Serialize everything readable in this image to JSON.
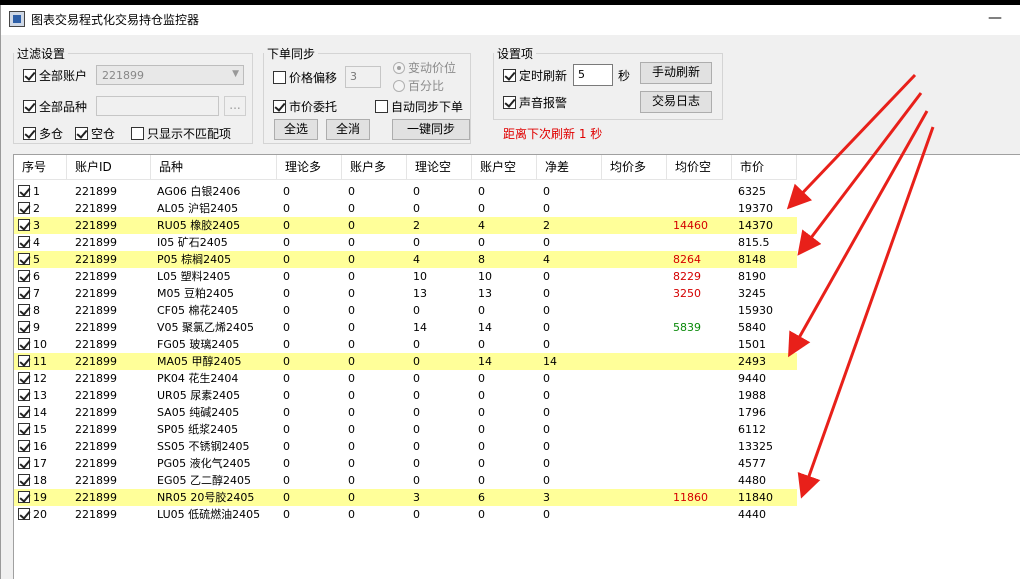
{
  "window": {
    "title": "图表交易程式化交易持仓监控器",
    "minimize": "—"
  },
  "filter": {
    "legend": "过滤设置",
    "all_accounts": "全部账户",
    "account_value": "221899",
    "all_products": "全部品种",
    "browse": "...",
    "long": "多仓",
    "short": "空仓",
    "only_mismatch": "只显示不匹配项"
  },
  "order_sync": {
    "legend": "下单同步",
    "price_offset": "价格偏移",
    "offset_value": "3",
    "radio_tick": "变动价位",
    "radio_percent": "百分比",
    "market_order": "市价委托",
    "auto_sync": "自动同步下单",
    "select_all": "全选",
    "cancel_all": "全消",
    "sync_button": "一键同步"
  },
  "settings": {
    "legend": "设置项",
    "timed_refresh": "定时刷新",
    "interval": "5",
    "unit": "秒",
    "manual_refresh": "手动刷新",
    "sound_alarm": "声音报警",
    "trade_log": "交易日志",
    "countdown": "距离下次刷新 1 秒"
  },
  "table": {
    "headers": [
      "序号",
      "账户ID",
      "品种",
      "理论多",
      "账户多",
      "理论空",
      "账户空",
      "净差",
      "均价多",
      "均价空",
      "市价"
    ],
    "rows": [
      {
        "no": "1",
        "acct": "221899",
        "prod": "AG06 白银2406",
        "tl": "0",
        "al": "0",
        "ts": "0",
        "as": "0",
        "net": "0",
        "avl": "",
        "avs": "",
        "avs_color": "",
        "price": "6325",
        "hl": false
      },
      {
        "no": "2",
        "acct": "221899",
        "prod": "AL05 沪铝2405",
        "tl": "0",
        "al": "0",
        "ts": "0",
        "as": "0",
        "net": "0",
        "avl": "",
        "avs": "",
        "avs_color": "",
        "price": "19370",
        "hl": false
      },
      {
        "no": "3",
        "acct": "221899",
        "prod": "RU05 橡胶2405",
        "tl": "0",
        "al": "0",
        "ts": "2",
        "as": "4",
        "net": "2",
        "avl": "",
        "avs": "14460",
        "avs_color": "red",
        "price": "14370",
        "hl": true
      },
      {
        "no": "4",
        "acct": "221899",
        "prod": "I05 矿石2405",
        "tl": "0",
        "al": "0",
        "ts": "0",
        "as": "0",
        "net": "0",
        "avl": "",
        "avs": "",
        "avs_color": "",
        "price": "815.5",
        "hl": false
      },
      {
        "no": "5",
        "acct": "221899",
        "prod": "P05 棕榈2405",
        "tl": "0",
        "al": "0",
        "ts": "4",
        "as": "8",
        "net": "4",
        "avl": "",
        "avs": "8264",
        "avs_color": "red",
        "price": "8148",
        "hl": true
      },
      {
        "no": "6",
        "acct": "221899",
        "prod": "L05 塑料2405",
        "tl": "0",
        "al": "0",
        "ts": "10",
        "as": "10",
        "net": "0",
        "avl": "",
        "avs": "8229",
        "avs_color": "red",
        "price": "8190",
        "hl": false
      },
      {
        "no": "7",
        "acct": "221899",
        "prod": "M05 豆粕2405",
        "tl": "0",
        "al": "0",
        "ts": "13",
        "as": "13",
        "net": "0",
        "avl": "",
        "avs": "3250",
        "avs_color": "red",
        "price": "3245",
        "hl": false
      },
      {
        "no": "8",
        "acct": "221899",
        "prod": "CF05 棉花2405",
        "tl": "0",
        "al": "0",
        "ts": "0",
        "as": "0",
        "net": "0",
        "avl": "",
        "avs": "",
        "avs_color": "",
        "price": "15930",
        "hl": false
      },
      {
        "no": "9",
        "acct": "221899",
        "prod": "V05 聚氯乙烯2405",
        "tl": "0",
        "al": "0",
        "ts": "14",
        "as": "14",
        "net": "0",
        "avl": "",
        "avs": "5839",
        "avs_color": "green",
        "price": "5840",
        "hl": false
      },
      {
        "no": "10",
        "acct": "221899",
        "prod": "FG05 玻璃2405",
        "tl": "0",
        "al": "0",
        "ts": "0",
        "as": "0",
        "net": "0",
        "avl": "",
        "avs": "",
        "avs_color": "",
        "price": "1501",
        "hl": false
      },
      {
        "no": "11",
        "acct": "221899",
        "prod": "MA05 甲醇2405",
        "tl": "0",
        "al": "0",
        "ts": "0",
        "as": "14",
        "net": "14",
        "avl": "",
        "avs": "",
        "avs_color": "",
        "price": "2493",
        "hl": true
      },
      {
        "no": "12",
        "acct": "221899",
        "prod": "PK04 花生2404",
        "tl": "0",
        "al": "0",
        "ts": "0",
        "as": "0",
        "net": "0",
        "avl": "",
        "avs": "",
        "avs_color": "",
        "price": "9440",
        "hl": false
      },
      {
        "no": "13",
        "acct": "221899",
        "prod": "UR05 尿素2405",
        "tl": "0",
        "al": "0",
        "ts": "0",
        "as": "0",
        "net": "0",
        "avl": "",
        "avs": "",
        "avs_color": "",
        "price": "1988",
        "hl": false
      },
      {
        "no": "14",
        "acct": "221899",
        "prod": "SA05 纯碱2405",
        "tl": "0",
        "al": "0",
        "ts": "0",
        "as": "0",
        "net": "0",
        "avl": "",
        "avs": "",
        "avs_color": "",
        "price": "1796",
        "hl": false
      },
      {
        "no": "15",
        "acct": "221899",
        "prod": "SP05 纸浆2405",
        "tl": "0",
        "al": "0",
        "ts": "0",
        "as": "0",
        "net": "0",
        "avl": "",
        "avs": "",
        "avs_color": "",
        "price": "6112",
        "hl": false
      },
      {
        "no": "16",
        "acct": "221899",
        "prod": "SS05 不锈钢2405",
        "tl": "0",
        "al": "0",
        "ts": "0",
        "as": "0",
        "net": "0",
        "avl": "",
        "avs": "",
        "avs_color": "",
        "price": "13325",
        "hl": false
      },
      {
        "no": "17",
        "acct": "221899",
        "prod": "PG05 液化气2405",
        "tl": "0",
        "al": "0",
        "ts": "0",
        "as": "0",
        "net": "0",
        "avl": "",
        "avs": "",
        "avs_color": "",
        "price": "4577",
        "hl": false
      },
      {
        "no": "18",
        "acct": "221899",
        "prod": "EG05 乙二醇2405",
        "tl": "0",
        "al": "0",
        "ts": "0",
        "as": "0",
        "net": "0",
        "avl": "",
        "avs": "",
        "avs_color": "",
        "price": "4480",
        "hl": false
      },
      {
        "no": "19",
        "acct": "221899",
        "prod": "NR05 20号胶2405",
        "tl": "0",
        "al": "0",
        "ts": "3",
        "as": "6",
        "net": "3",
        "avl": "",
        "avs": "11860",
        "avs_color": "red",
        "price": "11840",
        "hl": true
      },
      {
        "no": "20",
        "acct": "221899",
        "prod": "LU05 低硫燃油2405",
        "tl": "0",
        "al": "0",
        "ts": "0",
        "as": "0",
        "net": "0",
        "avl": "",
        "avs": "",
        "avs_color": "",
        "price": "4440",
        "hl": false
      }
    ]
  },
  "colors": {
    "highlight": "#ffff99",
    "countdown": "#e00000",
    "annotation_arrow": "#e8201a"
  },
  "annotation": {
    "arrow_count": 4,
    "icon": "red-arrow-icon"
  }
}
